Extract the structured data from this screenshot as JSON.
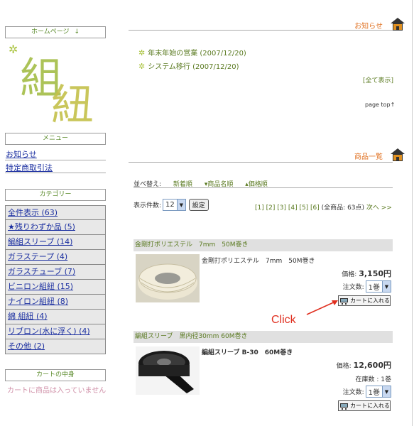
{
  "sidebar": {
    "home_header": "ホームページ",
    "home_arrow": "↓",
    "logo_text": "組紐",
    "menu_header": "メニュー",
    "menu_items": [
      "お知らせ",
      "特定商取引法"
    ],
    "category_header": "カテゴリー",
    "categories": [
      "全件表示 (63)",
      "★残りわずか品 (5)",
      "編組スリーブ (14)",
      "ガラステープ (4)",
      "ガラスチューブ (7)",
      "ビニロン組紐 (15)",
      "ナイロン組紐 (8)",
      "綿 組紐 (4)",
      "リブロン(水に浮く) (4)",
      "その他 (2)"
    ],
    "cart_header": "カートの中身",
    "cart_empty": "カートに商品は入っていません"
  },
  "news": {
    "title": "お知らせ",
    "items": [
      "年末年始の営業 (2007/12/20)",
      "システム移行 (2007/12/20)"
    ],
    "show_all": "[全て表示]",
    "page_top": "page top↑"
  },
  "products": {
    "title": "商品一覧",
    "sort_label": "並べ替え:",
    "sort_options": [
      "新着順",
      "▾商品名順",
      "▴価格順"
    ],
    "count_label": "表示件数:",
    "count_value": "12",
    "set_button": "設定",
    "pager": "[1] [2] [3] [4] [5] [6]",
    "total": "(全商品: 63点)",
    "next": "次へ >>",
    "items": [
      {
        "bar_title": "金剛打ポリエステル　7mm　50M巻き",
        "name": "金剛打ポリエステル　7mm　50M巻き",
        "price_label": "価格:",
        "price": "3,150円",
        "stock": "",
        "qty_label": "注文数:",
        "qty_value": "1巻",
        "cart_button": "カートに入れる"
      },
      {
        "bar_title": "編組スリーブ　黒内径30mm 60M巻き",
        "name": "編組スリーブ B-30　60M巻き",
        "price_label": "価格:",
        "price": "12,600円",
        "stock": "在庫数 : 1巻",
        "qty_label": "注文数:",
        "qty_value": "1巻",
        "cart_button": "カートに入れる"
      }
    ]
  },
  "annotation": {
    "click_label": "Click"
  },
  "colors": {
    "accent_orange": "#e07020",
    "link_green": "#5a7a20",
    "link_blue": "#1a2ea0",
    "annotation_red": "#e03020"
  }
}
